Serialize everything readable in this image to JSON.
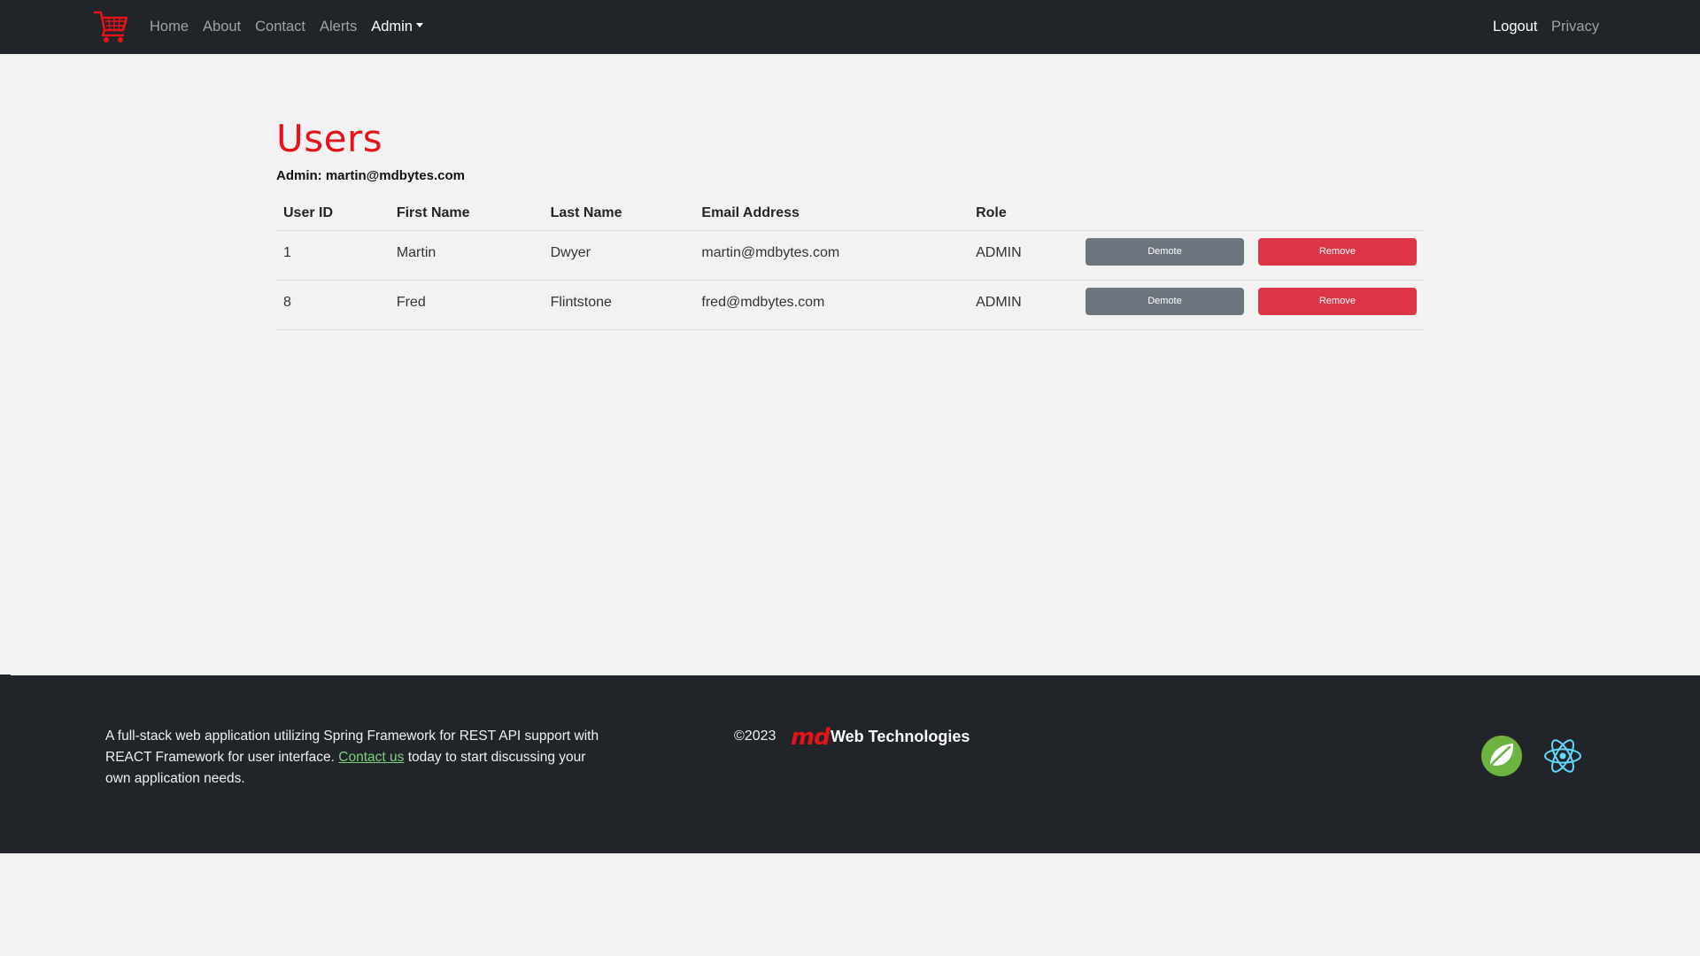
{
  "nav": {
    "brand_icon": "shopping-cart-icon",
    "links": [
      "Home",
      "About",
      "Contact",
      "Alerts"
    ],
    "admin_label": "Admin",
    "logout_label": "Logout",
    "privacy_label": "Privacy"
  },
  "main": {
    "title": "Users",
    "admin_line": "Admin: martin@mdbytes.com",
    "columns": [
      "User ID",
      "First Name",
      "Last Name",
      "Email Address",
      "Role"
    ],
    "rows": [
      {
        "id": "1",
        "first": "Martin",
        "last": "Dwyer",
        "email": "martin@mdbytes.com",
        "role": "ADMIN",
        "demote": "Demote",
        "remove": "Remove"
      },
      {
        "id": "8",
        "first": "Fred",
        "last": "Flintstone",
        "email": "fred@mdbytes.com",
        "role": "ADMIN",
        "demote": "Demote",
        "remove": "Remove"
      }
    ]
  },
  "footer": {
    "text_before": "A full-stack web application utilizing Spring Framework for REST API support with REACT Framework for user interface.",
    "link_text": "Contact us",
    "text_after": "today to start discussing your own application needs.",
    "copyright": "©2023",
    "logo_text": "md",
    "company": "Web Technologies",
    "icons": [
      "spring-icon",
      "react-icon"
    ]
  },
  "colors": {
    "accent": "#e8121a",
    "navbar_bg": "#212529",
    "demote_btn": "#6c757d",
    "remove_btn": "#dc3545",
    "link_green": "#7fd07f"
  }
}
